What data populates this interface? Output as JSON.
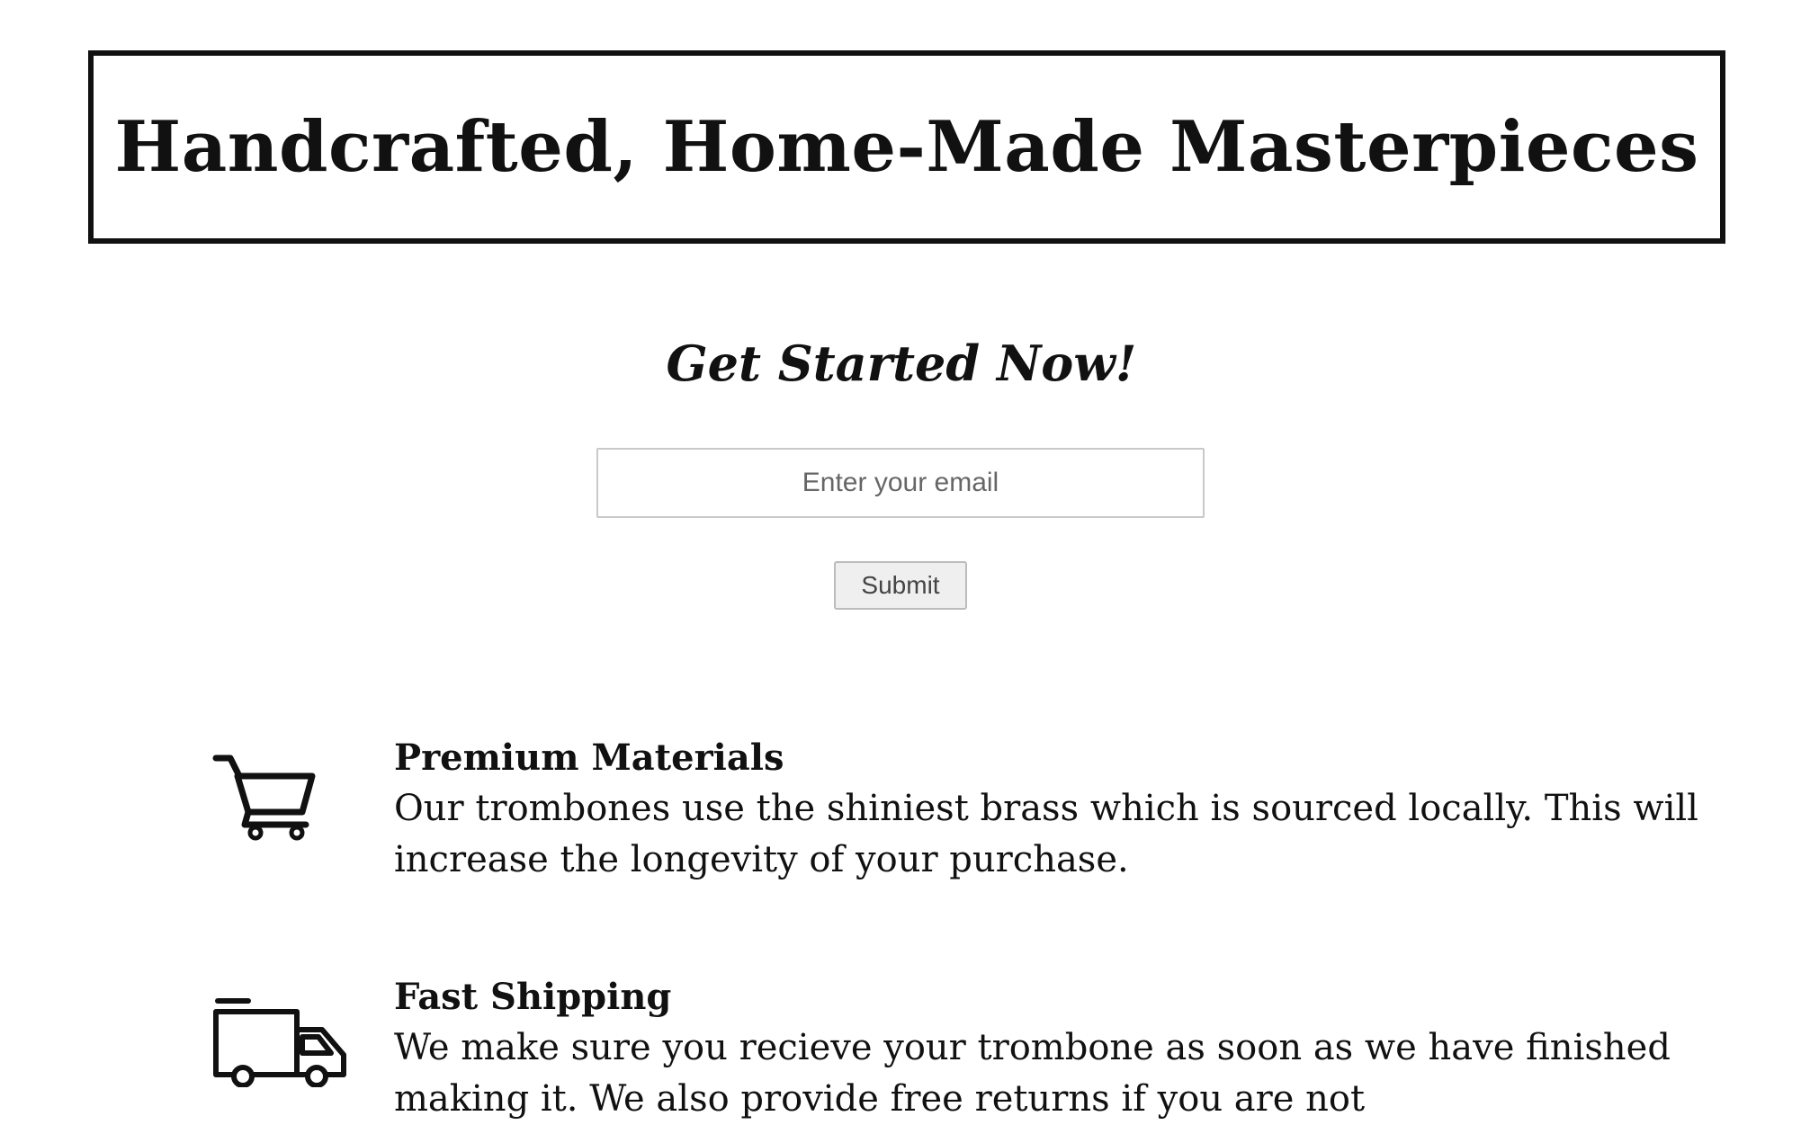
{
  "header": {
    "title": "Handcrafted, Home-Made Masterpieces"
  },
  "signup": {
    "heading": "Get Started Now!",
    "email_placeholder": "Enter your email",
    "email_value": "",
    "submit_label": "Submit"
  },
  "features": [
    {
      "icon": "shopping-cart-icon",
      "title": "Premium Materials",
      "description": "Our trombones use the shiniest brass which is sourced locally. This will increase the longevity of your purchase."
    },
    {
      "icon": "delivery-truck-icon",
      "title": "Fast Shipping",
      "description": "We make sure you recieve your trombone as soon as we have finished making it. We also provide free returns if you are not"
    }
  ]
}
